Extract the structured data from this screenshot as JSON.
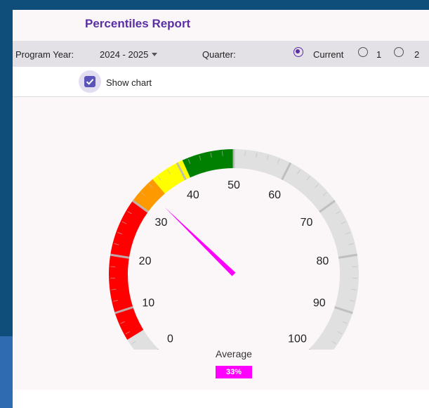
{
  "header": {
    "title": "Percentiles Report"
  },
  "filters": {
    "program_year_label": "Program Year:",
    "program_year_value": "2024 - 2025",
    "quarter_label": "Quarter:",
    "quarter_options": [
      "Current",
      "1",
      "2"
    ],
    "quarter_selected": "Current"
  },
  "show_chart": {
    "label": "Show chart",
    "checked": true
  },
  "gauge": {
    "min": 0,
    "max": 100,
    "value": 33,
    "tick_labels": [
      "0",
      "10",
      "20",
      "30",
      "40",
      "50",
      "60",
      "70",
      "80",
      "90",
      "100"
    ],
    "bands": [
      {
        "from": 0,
        "to": 5,
        "color": "#e0e0e0"
      },
      {
        "from": 5,
        "to": 30,
        "color": "#ff0000"
      },
      {
        "from": 30,
        "to": 35,
        "color": "#ff9900"
      },
      {
        "from": 35,
        "to": 41,
        "color": "#ffff00"
      },
      {
        "from": 41,
        "to": 50,
        "color": "#008000"
      },
      {
        "from": 50,
        "to": 100,
        "color": "#e0e0e0"
      }
    ],
    "needle_color": "#ff00ff",
    "caption": "Average",
    "value_label": "33%"
  }
}
